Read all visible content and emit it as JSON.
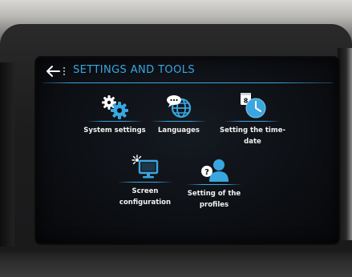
{
  "header": {
    "title": "SETTINGS AND TOOLS",
    "back_icon": "back-arrow-icon",
    "menu_icon": "vertical-dots-icon"
  },
  "tiles": [
    {
      "label": "System settings",
      "icon": "gears-icon"
    },
    {
      "label": "Languages",
      "icon": "globe-speech-icon"
    },
    {
      "label": "Setting the time-date",
      "icon": "calendar-clock-icon"
    },
    {
      "label": "Screen configuration",
      "icon": "monitor-brightness-icon"
    },
    {
      "label": "Setting of the profiles",
      "icon": "profile-question-icon"
    }
  ],
  "calendar_day": "8",
  "colors": {
    "accent": "#3aa6e0",
    "text": "#f2f2f2",
    "screen_bg": "#0b0d11"
  }
}
